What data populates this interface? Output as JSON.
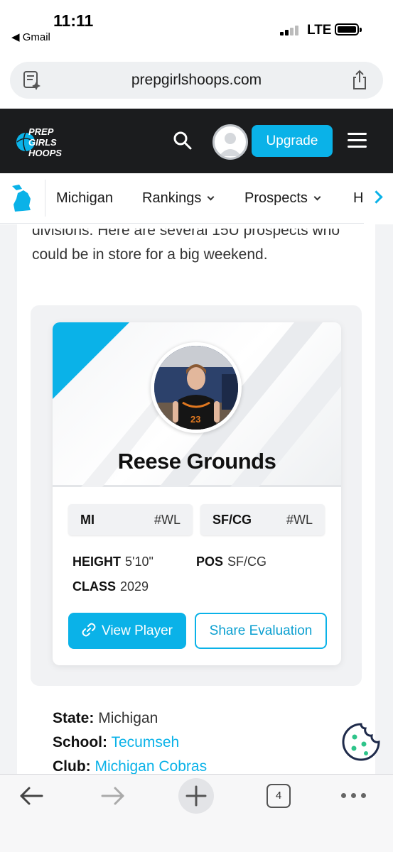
{
  "status_bar": {
    "time": "11:11",
    "back_app": "◀ Gmail",
    "network": "LTE"
  },
  "browser": {
    "url": "prepgirlshoops.com"
  },
  "site_header": {
    "logo_lines": [
      "PREP",
      "GIRLS",
      "HOOPS"
    ],
    "upgrade_label": "Upgrade"
  },
  "subnav": {
    "items": [
      "Michigan",
      "Rankings",
      "Prospects",
      "H"
    ]
  },
  "article": {
    "intro": "divisions. Here are several 15U prospects who could be in store for a big weekend."
  },
  "player_card": {
    "name": "Reese Grounds",
    "tags": [
      {
        "label": "MI",
        "value": "#WL"
      },
      {
        "label": "SF/CG",
        "value": "#WL"
      }
    ],
    "stats": {
      "height_label": "HEIGHT",
      "height_value": "5'10\"",
      "pos_label": "POS",
      "pos_value": "SF/CG",
      "class_label": "CLASS",
      "class_value": "2029"
    },
    "view_label": "View Player",
    "share_label": "Share Evaluation",
    "jersey_number": "23"
  },
  "player_info": {
    "state_label": "State:",
    "state_value": "Michigan",
    "school_label": "School:",
    "school_value": "Tecumseh",
    "club_label": "Club:",
    "club_value": "Michigan Cobras"
  },
  "toolbar": {
    "tab_count": "4"
  },
  "colors": {
    "accent": "#0ab2e8",
    "header_bg": "#1b1c1e"
  }
}
